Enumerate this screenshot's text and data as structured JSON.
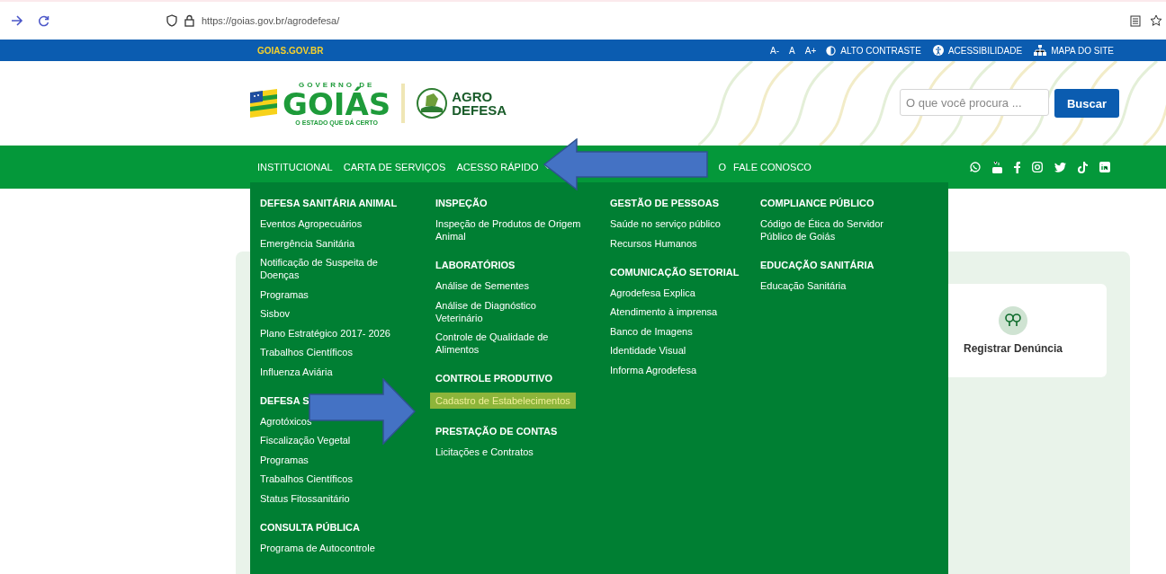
{
  "browser": {
    "url": "https://goias.gov.br/agrodefesa/"
  },
  "gov_bar": {
    "brand": "GOIAS.GOV.BR",
    "font_sizes": [
      "A-",
      "A",
      "A+"
    ],
    "links": [
      {
        "label": "ALTO CONTRASTE",
        "kind": "contrast"
      },
      {
        "label": "ACESSIBILIDADE",
        "kind": "accessibility"
      },
      {
        "label": "MAPA DO SITE",
        "kind": "sitemap"
      }
    ]
  },
  "header": {
    "logo_top": "GOVERNO DE",
    "logo_main": "GOIÁS",
    "logo_tagline": "O ESTADO QUE DÁ CERTO",
    "agency_line_1": "AGRO",
    "agency_line_2": "DEFESA",
    "search": {
      "placeholder": "O que você procura ..."
    },
    "search_button": "Buscar"
  },
  "nav": {
    "items": [
      {
        "label": "INSTITUCIONAL",
        "kind": "plain"
      },
      {
        "label": "CARTA DE SERVIÇOS",
        "kind": "plain"
      },
      {
        "label": "ACESSO RÁPIDO",
        "kind": "dropdown"
      },
      {
        "label": "O",
        "kind": "partial"
      },
      {
        "label": "FALE CONOSCO",
        "kind": "plain"
      }
    ]
  },
  "menu": {
    "columns": [
      {
        "groups": [
          {
            "heading": "DEFESA SANITÁRIA ANIMAL",
            "items": [
              {
                "label": "Eventos Agropecuários",
                "selected": false
              },
              {
                "label": "Emergência Sanitária",
                "selected": false
              },
              {
                "label": "Notificação de Suspeita de Doenças",
                "selected": false
              },
              {
                "label": "Programas",
                "selected": false
              },
              {
                "label": "Sisbov",
                "selected": false
              },
              {
                "label": "Plano Estratégico 2017- 2026",
                "selected": false
              },
              {
                "label": "Trabalhos Científicos",
                "selected": false
              },
              {
                "label": "Influenza Aviária",
                "selected": false
              }
            ]
          },
          {
            "heading": "DEFESA S",
            "items": [
              {
                "label": "Agrotóxicos",
                "selected": false
              },
              {
                "label": "Fiscalização Vegetal",
                "selected": false
              },
              {
                "label": "Programas",
                "selected": false
              },
              {
                "label": "Trabalhos Científicos",
                "selected": false
              },
              {
                "label": "Status Fitossanitário",
                "selected": false
              }
            ]
          },
          {
            "heading": "CONSULTA PÚBLICA",
            "items": [
              {
                "label": "Programa de Autocontrole",
                "selected": false
              }
            ]
          }
        ]
      },
      {
        "groups": [
          {
            "heading": "INSPEÇÃO",
            "items": [
              {
                "label": "Inspeção de Produtos de Origem Animal",
                "selected": false
              }
            ]
          },
          {
            "heading": "LABORATÓRIOS",
            "items": [
              {
                "label": "Análise de Sementes",
                "selected": false
              },
              {
                "label": "Análise de Diagnóstico Veterinário",
                "selected": false
              },
              {
                "label": "Controle de Qualidade de Alimentos",
                "selected": false
              }
            ]
          },
          {
            "heading": "CONTROLE PRODUTIVO",
            "items": [
              {
                "label": "Cadastro de Estabelecimentos",
                "selected": true
              }
            ]
          },
          {
            "heading": "PRESTAÇÃO DE CONTAS",
            "items": [
              {
                "label": "Licitações e Contratos",
                "selected": false
              }
            ]
          }
        ]
      },
      {
        "groups": [
          {
            "heading": "GESTÃO DE PESSOAS",
            "items": [
              {
                "label": "Saúde no serviço público",
                "selected": false
              },
              {
                "label": "Recursos Humanos",
                "selected": false
              }
            ]
          },
          {
            "heading": "COMUNICAÇÃO SETORIAL",
            "items": [
              {
                "label": "Agrodefesa Explica",
                "selected": false
              },
              {
                "label": "Atendimento à imprensa",
                "selected": false
              },
              {
                "label": "Banco de Imagens",
                "selected": false
              },
              {
                "label": "Identidade Visual",
                "selected": false
              },
              {
                "label": "Informa Agrodefesa",
                "selected": false
              }
            ]
          }
        ]
      },
      {
        "groups": [
          {
            "heading": "COMPLIANCE PÚBLICO",
            "items": [
              {
                "label": "Código de Ética do Servidor Público de Goiás",
                "selected": false
              }
            ]
          },
          {
            "heading": "EDUCAÇÃO SANITÁRIA",
            "items": [
              {
                "label": "Educação Sanitária",
                "selected": false
              }
            ]
          }
        ]
      }
    ]
  },
  "page": {
    "card": {
      "label": "Registrar Denúncia"
    }
  }
}
